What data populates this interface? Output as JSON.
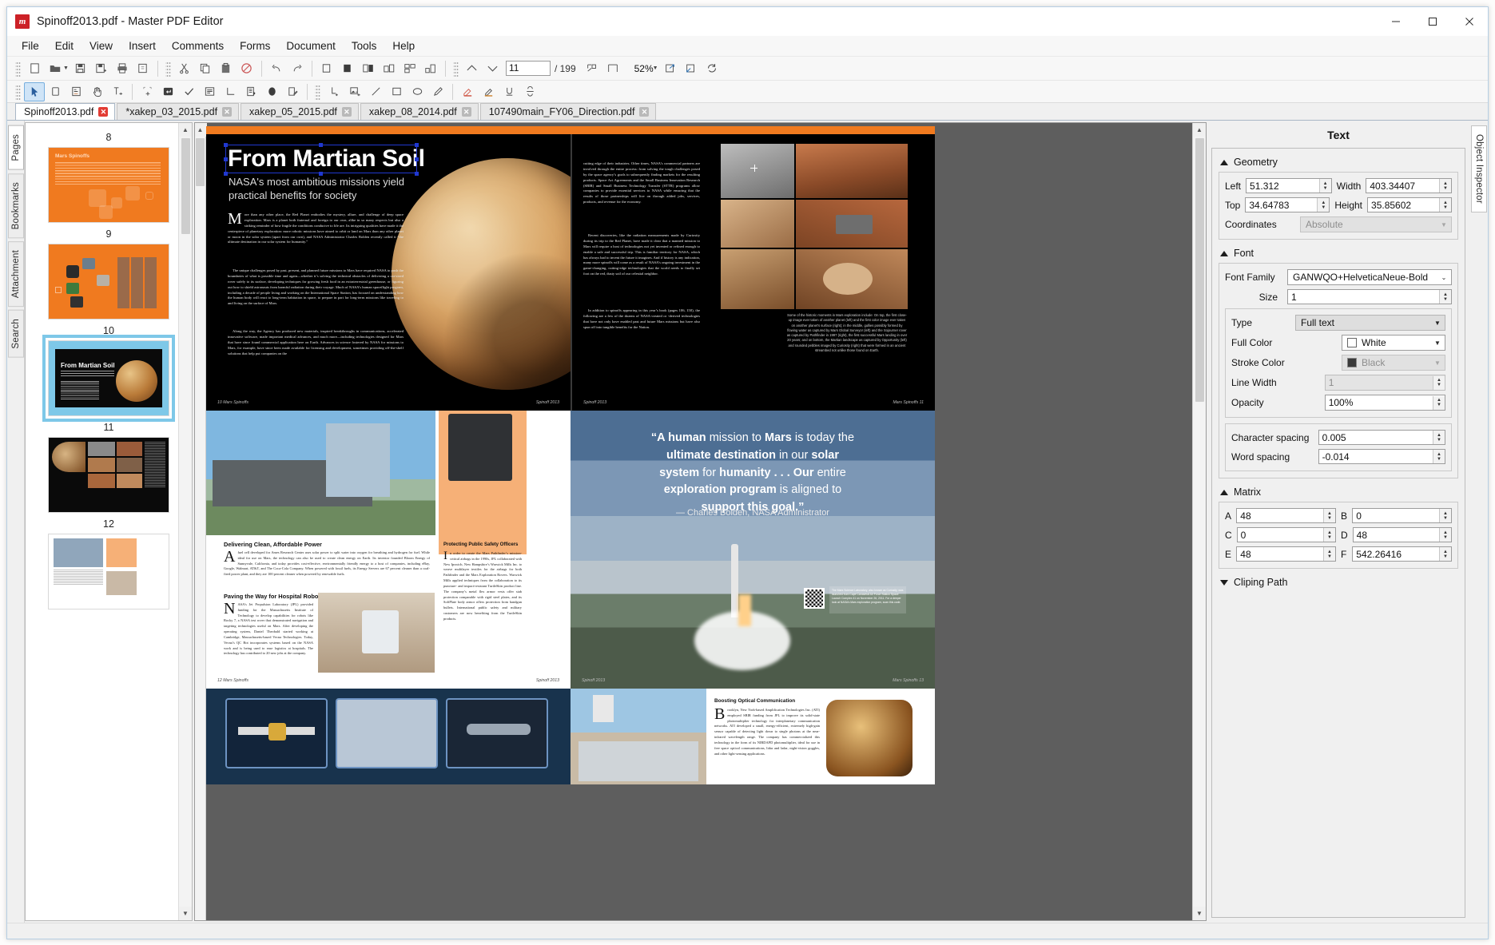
{
  "window": {
    "title": "Spinoff2013.pdf - Master PDF Editor",
    "app_icon": "m",
    "minimize": "—",
    "maximize": "☐",
    "close": "✕"
  },
  "menubar": {
    "items": [
      {
        "label": "File"
      },
      {
        "label": "Edit"
      },
      {
        "label": "View"
      },
      {
        "label": "Insert"
      },
      {
        "label": "Comments"
      },
      {
        "label": "Forms"
      },
      {
        "label": "Document"
      },
      {
        "label": "Tools"
      },
      {
        "label": "Help"
      }
    ]
  },
  "toolbar_main": {
    "page_number": "11",
    "page_total": "/ 199",
    "zoom_level": "52%",
    "buttons": [
      {
        "name": "new-document-icon"
      },
      {
        "name": "open-document-icon"
      },
      {
        "name": "save-icon"
      },
      {
        "name": "save-as-icon"
      },
      {
        "name": "print-icon"
      },
      {
        "name": "document-properties-icon"
      },
      {
        "name": "cut-icon"
      },
      {
        "name": "copy-icon"
      },
      {
        "name": "paste-icon"
      },
      {
        "name": "delete-icon"
      },
      {
        "name": "undo-icon"
      },
      {
        "name": "redo-icon"
      },
      {
        "name": "page-single-icon"
      },
      {
        "name": "page-filled-icon"
      },
      {
        "name": "page-facing-icon"
      },
      {
        "name": "page-cover-icon"
      },
      {
        "name": "page-continuous-icon"
      },
      {
        "name": "previous-page-icon"
      },
      {
        "name": "next-page-icon"
      },
      {
        "name": "zoom-out-icon"
      },
      {
        "name": "zoom-selection-icon"
      },
      {
        "name": "fit-page-icon"
      },
      {
        "name": "fit-width-icon"
      },
      {
        "name": "fit-visible-icon"
      },
      {
        "name": "zoom-in-icon"
      },
      {
        "name": "rotate-icon"
      }
    ]
  },
  "toolbar_tools": {
    "buttons": [
      {
        "name": "select-tool-icon",
        "active": true
      },
      {
        "name": "text-cursor-icon"
      },
      {
        "name": "form-field-icon"
      },
      {
        "name": "hand-tool-icon"
      },
      {
        "name": "edit-text-icon"
      },
      {
        "name": "add-note-icon"
      },
      {
        "name": "text-box-icon"
      },
      {
        "name": "stamp-check-icon"
      },
      {
        "name": "sticky-note-icon"
      },
      {
        "name": "measure-icon"
      },
      {
        "name": "list-box-icon"
      },
      {
        "name": "ellipse-filled-icon"
      },
      {
        "name": "edit-page-icon"
      },
      {
        "name": "add-dimension-icon"
      },
      {
        "name": "add-image-icon"
      },
      {
        "name": "line-tool-icon"
      },
      {
        "name": "rectangle-tool-icon"
      },
      {
        "name": "ellipse-tool-icon"
      },
      {
        "name": "pencil-tool-icon"
      },
      {
        "name": "highlight-icon"
      },
      {
        "name": "text-highlight-icon"
      },
      {
        "name": "underline-icon"
      },
      {
        "name": "strikethrough-icon"
      }
    ]
  },
  "document_tabs": [
    {
      "label": "Spinoff2013.pdf",
      "active": true,
      "close": "✕"
    },
    {
      "label": "*xakep_03_2015.pdf",
      "active": false,
      "close": "✕"
    },
    {
      "label": "xakep_05_2015.pdf",
      "active": false,
      "close": "✕"
    },
    {
      "label": "xakep_08_2014.pdf",
      "active": false,
      "close": "✕"
    },
    {
      "label": "107490main_FY06_Direction.pdf",
      "active": false,
      "close": "✕"
    }
  ],
  "side_tabs": [
    {
      "label": "Pages",
      "active": true
    },
    {
      "label": "Bookmarks",
      "active": false
    },
    {
      "label": "Attachment",
      "active": false
    },
    {
      "label": "Search",
      "active": false
    }
  ],
  "thumbnails": [
    {
      "number": "8",
      "kind": "orange",
      "selected": false,
      "title": "Mars Spinoffs"
    },
    {
      "number": "9",
      "kind": "orange2",
      "selected": false,
      "title": ""
    },
    {
      "number": "10",
      "kind": "black",
      "selected": true,
      "title": "From Martian Soil",
      "subtitle": "NASA's most ambitious missions yield"
    },
    {
      "number": "11",
      "kind": "mosaic",
      "selected": false,
      "title": ""
    },
    {
      "number": "12",
      "kind": "white",
      "selected": false,
      "title": ""
    }
  ],
  "page": {
    "headline": "From Martian Soil",
    "subhead": "NASA's most ambitious missions yield practical benefits for society",
    "body_left": "ore than any other place, the Red Planet embodies the mystery, allure, and challenge of deep space exploration. Mars is a planet both fraternal and foreign to our own, alike in so many respects but also a striking reminder of how fragile the conditions conducive to life are. Its intriguing qualities have made it the centerpiece of planetary exploration: more robotic missions have aimed to orbit or land on Mars than any other planet or moon in the solar system (apart from our own), and NASA Administrator Charles Bolden recently called it “the ultimate destination in our solar system for humanity.”",
    "body_left_2": "The unique challenges posed by past, present, and planned future missions to Mars have required NASA to push the boundaries of what is possible time and again—whether it’s solving the technical obstacles of delivering a car-sized rover safely to its surface, developing techniques for growing fresh food in an extraterrestrial greenhouse, or figuring out how to shield astronauts from harmful radiation during their voyage. Much of NASA’s human spaceflight program, including a decade of people living and working on the International Space Station, has focused on understanding how the human body will react to long-term habitation in space, to prepare in part for long-term missions like traveling to and living on the surface of Mars.",
    "body_left_3": "Along the way, the Agency has produced new materials, inspired breakthroughs in communications, accelerated innovative software, made important medical advances, and much more—including technologies designed for Mars that have since found commercial application here on Earth. Advances in science fostered by NASA for missions to Mars, for example, have since been made available for licensing and development, sometimes providing off-the-shelf solutions that help put companies on the",
    "body_right_1": "cutting edge of their industries. Other times, NASA’s commercial partners are involved through the entire process: from solving the tough challenges posed by the space agency’s goals to subsequently finding markets for the resulting products. Space Act Agreements and the Small Business Innovation Research (SBIR) and Small Business Technology Transfer (STTR) programs allow companies to provide essential services to NASA while ensuring that the results of those partnerships will live on through added jobs, services, products, and revenue for the economy.",
    "body_right_2": "Recent discoveries, like the radiation measurements made by Curiosity during its trip to the Red Planet, have made it clear that a manned mission to Mars will require a host of technologies not yet invented or refined enough to enable a safe and successful trip. This is familiar territory for NASA, which has always had to invent the future it imagines. And if history is any indication, many more spinoffs will come as a result of NASA’s ongoing investment in the game-changing, cutting-edge technologies that the world needs to finally set foot on the red, dusty soil of our celestial neighbor.",
    "body_right_3": "In addition to spinoffs appearing in this year’s book (pages 106, 150), the following are a few of the dozens of NASA-created or -derived technologies that have not only have enabled past and future Mars missions but have also spun off into tangible benefits for the Nation.",
    "photo_caption": "Some of the historic moments in Mars exploration include: On top, the first close-up image ever taken of another planet (left) and the first color image ever taken on another planet’s surface (right); in the middle, gullies possibly formed by flowing water as captured by Mars Global Surveyor (left) and the Sojourner rover as captured by Pathfinder in 1997 (right), the first successful Mars landing in over 20 years; and on bottom, the Martian landscape as captured by Opportunity (left) and rounded pebbles imaged by Curiosity (right) that were formed in an ancient streambed not unlike those found on Earth.",
    "footer_left_10": "10   Mars Spinoffs",
    "footer_right_10": "Spinoff 2013",
    "footer_left_11": "Spinoff 2013",
    "footer_right_11": "Mars Spinoffs   11",
    "quote_line1_a": "“A human",
    "quote_line1_b": " mission to ",
    "quote_line1_c": "Mars",
    "quote_line1_d": " is today the",
    "quote_line2_a": "ultimate destination",
    "quote_line2_b": " in our ",
    "quote_line2_c": "solar",
    "quote_line3_a": "system",
    "quote_line3_b": " for ",
    "quote_line3_c": "humanity . . . Our",
    "quote_line3_d": " entire",
    "quote_line4_a": "exploration program",
    "quote_line4_b": " is aligned to",
    "quote_line5": "support this goal.”",
    "quote_attribution": "— Charles Bolden, NASA Administrator",
    "article1_head": "Delivering Clean, Affordable Power",
    "article1_body": "fuel cell developed for Ames Research Center uses solar power to split water into oxygen for breathing and hydrogen for fuel. While ideal for use on Mars, the technology can also be used to create clean energy on Earth. Its inventor founded Bloom Energy of Sunnyvale, California, and today provides cost-effective, environmentally friendly energy to a host of companies, including eBay, Google, Walmart, AT&T, and The Coca-Cola Company. When powered with fossil fuels, its Energy Servers are 67 percent cleaner than a coal-fired power plant, and they are 100 percent cleaner when powered by renewable fuels.",
    "article2_head": "Paving the Way for Hospital Robots",
    "article2_body": "ASA’s Jet Propulsion Laboratory (JPL) provided funding for the Massachusetts Institute of Technology to develop capabilities for robots like Rocky 7, a NASA test rover that demonstrated navigation and targeting technologies useful on Mars. After developing the operating system, Daniel Theobald started working at Cambridge, Massachusetts-based Vecna Technologies. Today, Vecna’s QC Bot incorporates systems based on the NASA work and is being used to ease logistics at hospitals. The technology has contributed to 20 new jobs at the company.",
    "article3_head": "Protecting Public Safety Officers",
    "article3_body": "n order to create the Mars Pathfinder’s mission-critical airbags in the 1990s, JPL collaborated with New Ipswich, New Hampshire’s Warwick Mills Inc. to weave multilayer textiles for the airbags for both Pathfinder and the Mars Exploration Rovers. Warwick Mills applied techniques from the collaboration to its puncture- and impact-resistant TurtleSkin product line. The company’s metal flex armor vests offer stab protection comparable with rigid steel plates, and its SoftPlate body armor offers protection from handgun bullets. International public safety and military customers are now benefiting from the TurtleSkin products.",
    "article4_head": "Boosting Optical Communication",
    "article4_body": "rooklyn, New York-based Amplification Technologies Inc. (ATI) employed SBIR funding from JPL to improve its solid-state photomultiplier technology for interplanetary communication networks. ATI developed a small, energy-efficient, extremely high-gain sensor capable of detecting light down to single photons at the near-infrared wavelength range. The company has commercialized this technology in the form of its NIRDAPD photomultiplier, ideal for use in free space optical communications, lidar and ladar, night-vision goggles, and other light-sensing applications.",
    "footer_left_12": "12   Mars Spinoffs",
    "footer_right_12": "Spinoff 2013",
    "footer_left_13": "Spinoff 2013",
    "footer_right_13": "Mars Spinoffs   13",
    "launch_caption": "The Mars Science Laboratory, also known as Curiosity, was launched from Cape Canaveral Air Force Station Space Launch Complex 41 on November 26, 2011. For a deeper look at NASA’s Mars exploration program, scan this code."
  },
  "inspector": {
    "title": "Text",
    "right_tab": "Object Inspector",
    "geometry": {
      "header": "Geometry",
      "left_label": "Left",
      "left_value": "51.312",
      "width_label": "Width",
      "width_value": "403.34407",
      "top_label": "Top",
      "top_value": "34.64783",
      "height_label": "Height",
      "height_value": "35.85602",
      "coordinates_label": "Coordinates",
      "coordinates_value": "Absolute"
    },
    "font": {
      "header": "Font",
      "family_label": "Font Family",
      "family_value": "GANWQO+HelveticaNeue-Bold",
      "size_label": "Size",
      "size_value": "1",
      "type_label": "Type",
      "type_value": "Full text",
      "full_color_label": "Full Color",
      "full_color_value": "White",
      "full_color_hex": "#ffffff",
      "stroke_color_label": "Stroke Color",
      "stroke_color_value": "Black",
      "stroke_color_hex": "#3a3a3a",
      "line_width_label": "Line Width",
      "line_width_value": "1",
      "opacity_label": "Opacity",
      "opacity_value": "100%",
      "char_spacing_label": "Character spacing",
      "char_spacing_value": "0.005",
      "word_spacing_label": "Word spacing",
      "word_spacing_value": "-0.014"
    },
    "matrix": {
      "header": "Matrix",
      "a_label": "A",
      "a_value": "48",
      "b_label": "B",
      "b_value": "0",
      "c_label": "C",
      "c_value": "0",
      "d_label": "D",
      "d_value": "48",
      "e_label": "E",
      "e_value": "48",
      "f_label": "F",
      "f_value": "542.26416"
    },
    "clipping": {
      "header": "Cliping Path"
    }
  }
}
